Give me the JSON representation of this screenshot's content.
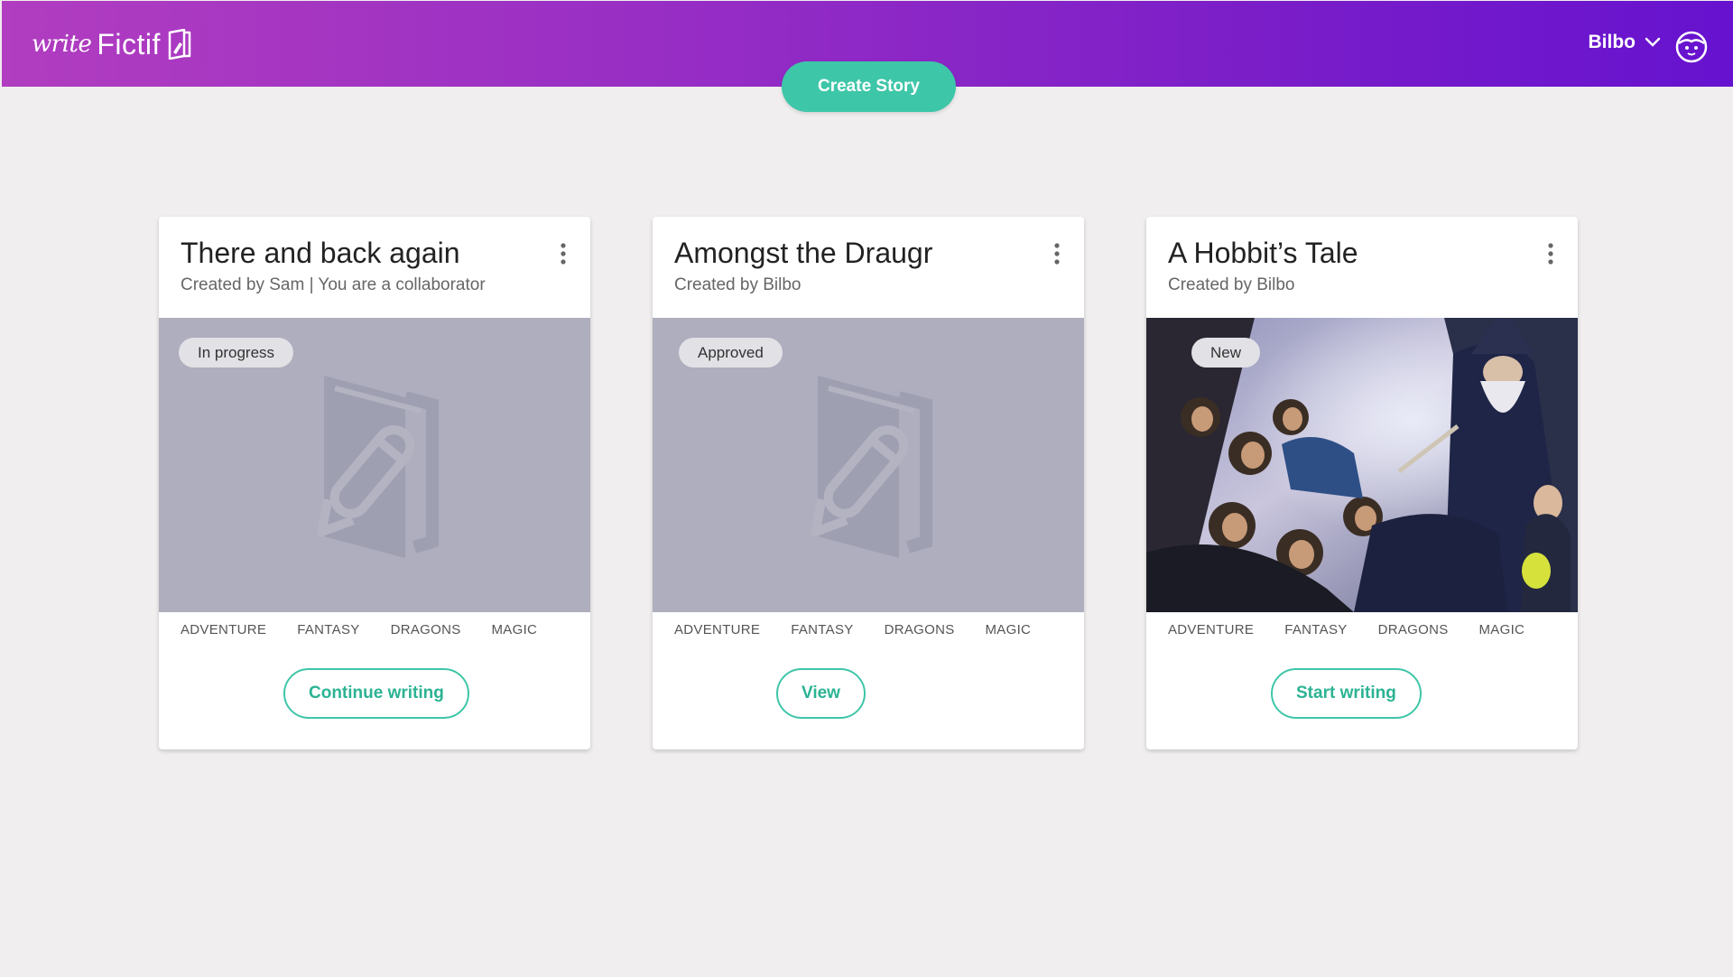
{
  "header": {
    "logo_script": "write",
    "logo_text": "Fictif",
    "user_name": "Bilbo",
    "gradient_colors": [
      "#b13dc0",
      "#6612cf"
    ]
  },
  "create_story_label": "Create Story",
  "accent_color": "#3ec6a8",
  "stories": [
    {
      "title": "There and back again",
      "subtitle": "Created by Sam | You are a collaborator",
      "status": "In progress",
      "tags": [
        "ADVENTURE",
        "FANTASY",
        "DRAGONS",
        "MAGIC"
      ],
      "action": "Continue writing",
      "cover": "placeholder-book-icon"
    },
    {
      "title": "Amongst the Draugr",
      "subtitle": "Created by Bilbo",
      "status": "Approved",
      "tags": [
        "ADVENTURE",
        "FANTASY",
        "DRAGONS",
        "MAGIC"
      ],
      "action": "View",
      "cover": "placeholder-book-icon"
    },
    {
      "title": "A Hobbit’s Tale",
      "subtitle": "Created by Bilbo",
      "status": "New",
      "tags": [
        "ADVENTURE",
        "FANTASY",
        "DRAGONS",
        "MAGIC"
      ],
      "action": "Start writing",
      "cover": "illustration-wizard-dwarves-hobbit"
    }
  ]
}
